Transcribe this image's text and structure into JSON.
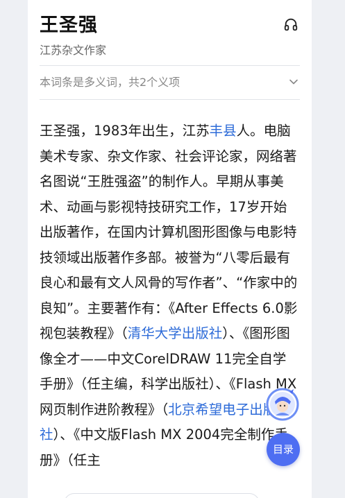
{
  "entry": {
    "title": "王圣强",
    "subtitle": "江苏杂文作家",
    "polysemy_text": "本词条是多义词，共2个义项"
  },
  "summary": {
    "s1": "王圣强，1983年出生，江苏",
    "link1": "丰县",
    "s2": "人。电脑美术专家、杂文作家、社会评论家，网络著名图说“王胜强盗”的制作人。早期从事美术、动画与影视特技研究工作，17岁开始出版著作，在国内计算机图形图像与电影特技领域出版著作多部。被誉为“八零后最有良心和最有文人风骨的写作者”、“作家中的良知”。主要著作有：《After Effects 6.0影视包装教程》（",
    "link2": "清华大学出版社",
    "s3": "）、《图形图像全才——中文CorelDRAW 11完全自学手册》（任主编，科学出版社）、《Flash MX网页制作进阶教程》（",
    "link3": "北京希望电子出版社",
    "s4": "）、《中文版Flash MX 2004完全制作手册》（任主"
  },
  "floating": {
    "toc_label": "目录"
  },
  "colors": {
    "link": "#2d6bd8",
    "accent": "#4e6ef2"
  },
  "icons": [
    "headphones-icon",
    "chevron-down-icon",
    "assistant-avatar-icon"
  ]
}
